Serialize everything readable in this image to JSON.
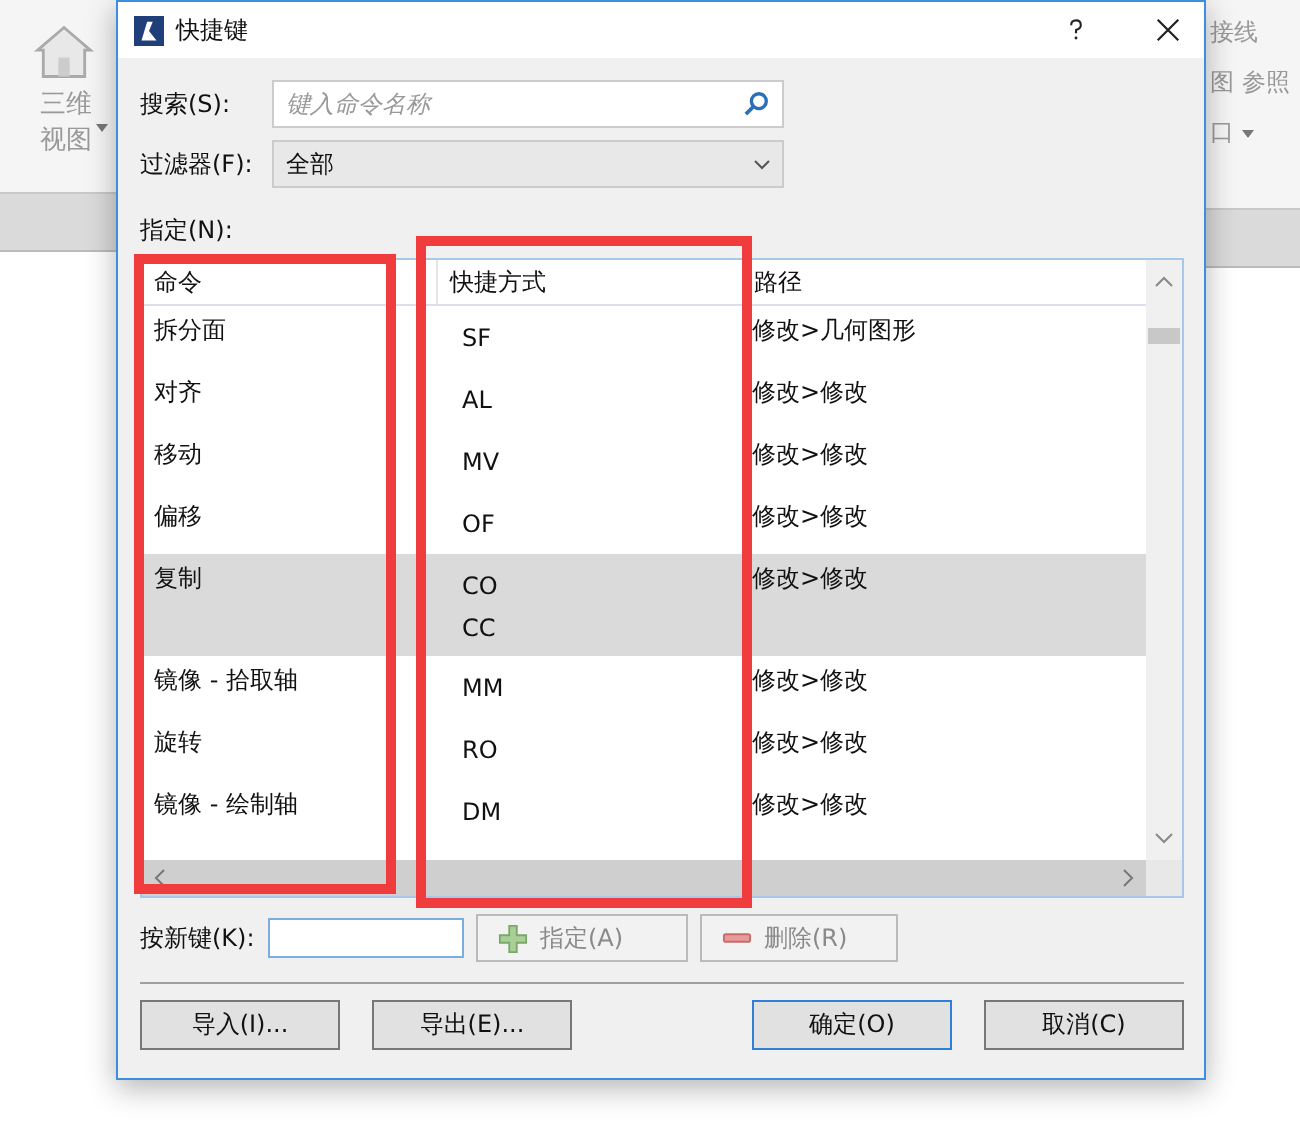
{
  "background_app": {
    "left_ribbon": {
      "label_lines": [
        "三维",
        "视图"
      ]
    },
    "right_ribbon": {
      "items": [
        "接线",
        "图",
        "参照",
        "口"
      ]
    }
  },
  "window": {
    "title": "快捷键"
  },
  "search": {
    "label": "搜索(S):",
    "placeholder": "键入命令名称"
  },
  "filter": {
    "label": "过滤器(F):",
    "value": "全部"
  },
  "assign_label": "指定(N):",
  "table": {
    "columns": [
      "命令",
      "快捷方式",
      "路径"
    ],
    "rows": [
      {
        "command": "拆分面",
        "shortcuts": [
          "SF"
        ],
        "path": "修改>几何图形",
        "selected": false
      },
      {
        "command": "对齐",
        "shortcuts": [
          "AL"
        ],
        "path": "修改>修改",
        "selected": false
      },
      {
        "command": "移动",
        "shortcuts": [
          "MV"
        ],
        "path": "修改>修改",
        "selected": false
      },
      {
        "command": "偏移",
        "shortcuts": [
          "OF"
        ],
        "path": "修改>修改",
        "selected": false
      },
      {
        "command": "复制",
        "shortcuts": [
          "CO",
          "CC"
        ],
        "path": "修改>修改",
        "selected": true
      },
      {
        "command": "镜像 - 拾取轴",
        "shortcuts": [
          "MM"
        ],
        "path": "修改>修改",
        "selected": false
      },
      {
        "command": "旋转",
        "shortcuts": [
          "RO"
        ],
        "path": "修改>修改",
        "selected": false
      },
      {
        "command": "镜像 - 绘制轴",
        "shortcuts": [
          "DM"
        ],
        "path": "修改>修改",
        "selected": false
      }
    ]
  },
  "new_key": {
    "label": "按新键(K):",
    "assign_button": "指定(A)",
    "remove_button": "删除(R)",
    "disabled": true
  },
  "buttons": [
    {
      "label": "导入(I)...",
      "default": false
    },
    {
      "label": "导出(E)...",
      "default": false
    },
    {
      "label": "确定(O)",
      "default": true
    },
    {
      "label": "取消(C)",
      "default": false
    }
  ],
  "annotations": [
    {
      "kind": "rectangle",
      "color": "#f03c3c"
    },
    {
      "kind": "rectangle",
      "color": "#f03c3c"
    }
  ]
}
